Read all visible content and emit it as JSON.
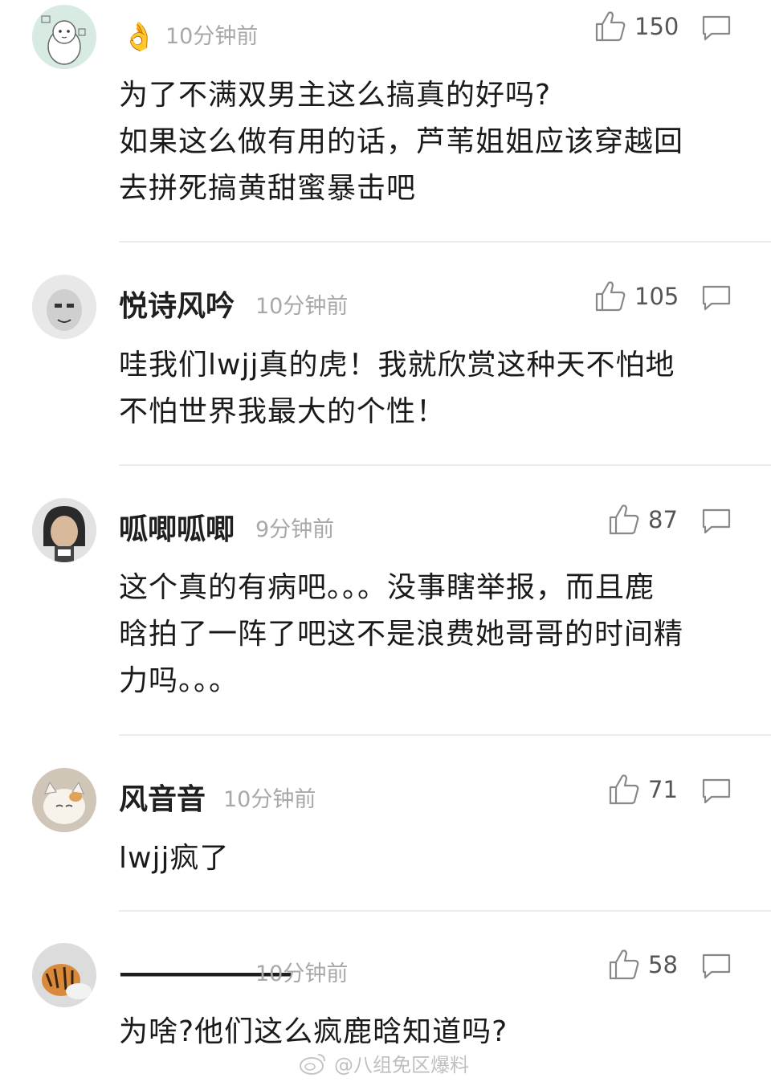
{
  "comments": [
    {
      "name": "",
      "badge": "👌",
      "time": "10分钟前",
      "likes": "150",
      "lines": [
        "为了不满双男主这么搞真的好吗?",
        "如果这么做有用的话，芦苇姐姐应该穿越回",
        "去拼死搞黄甜蜜暴击吧"
      ]
    },
    {
      "name": "悦诗风吟",
      "time": "10分钟前",
      "likes": "105",
      "lines": [
        "哇我们lwjj真的虎！我就欣赏这种天不怕地",
        "不怕世界我最大的个性！"
      ]
    },
    {
      "name": "呱唧呱唧",
      "time": "9分钟前",
      "likes": "87",
      "lines": [
        "这个真的有病吧。。。没事瞎举报，而且鹿",
        "晗拍了一阵了吧这不是浪费她哥哥的时间精",
        "力吗。。。"
      ]
    },
    {
      "name": "风音音",
      "time": "10分钟前",
      "likes": "71",
      "lines": [
        "lwjj疯了"
      ]
    },
    {
      "name": "———————",
      "time": "10分钟前",
      "likes": "58",
      "lines": [
        "为啥?他们这么疯鹿晗知道吗?"
      ]
    }
  ],
  "watermark": "@八组免区爆料",
  "icons": {
    "like": "thumbs-up-icon",
    "reply": "comment-bubble-icon",
    "watermark": "weibo-logo-icon"
  },
  "colors": {
    "time": "#a8a8a8",
    "badge": "#f5b800"
  }
}
